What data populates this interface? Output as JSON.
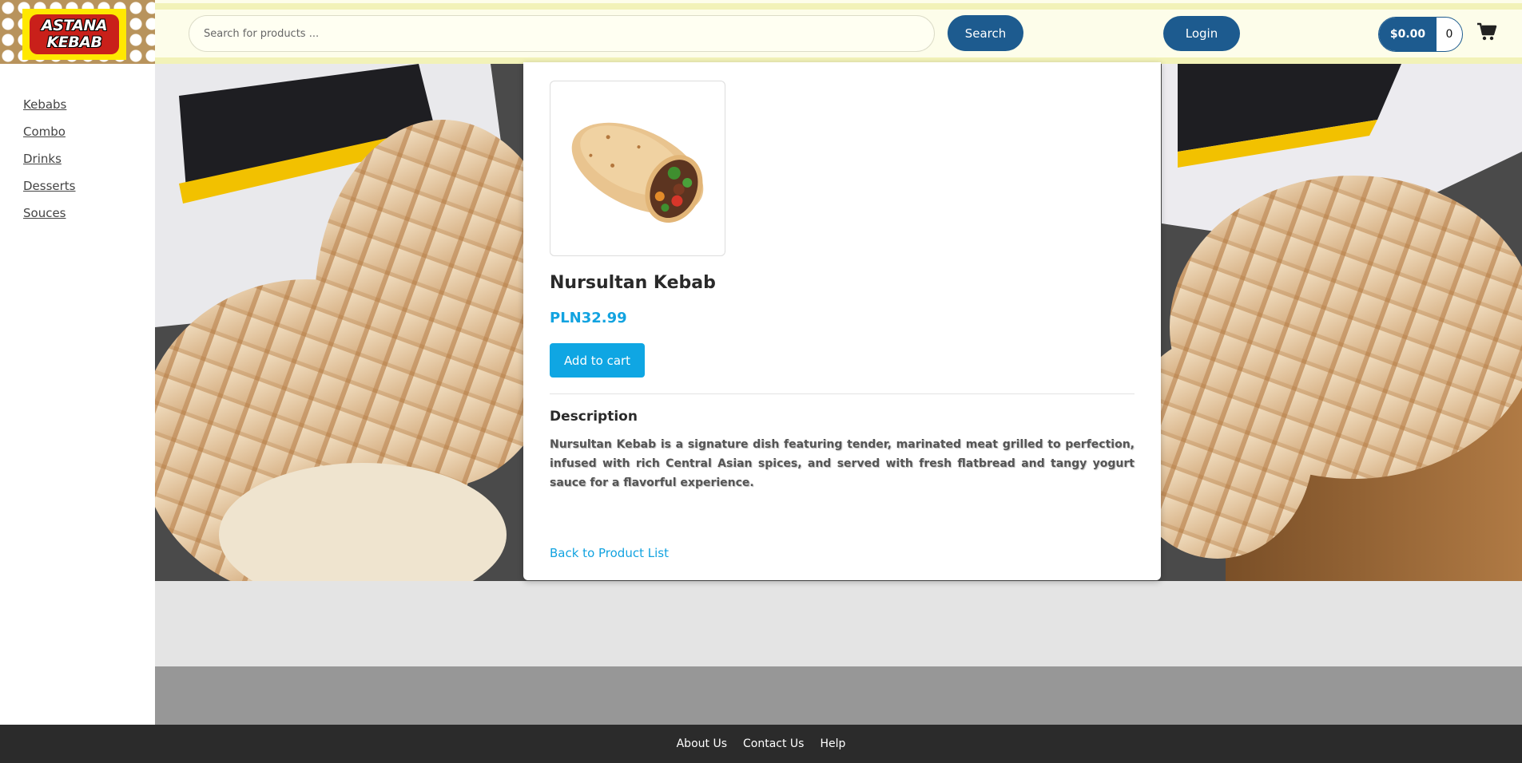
{
  "brand": {
    "logo_line1": "ASTANA",
    "logo_line2": "KEBAB",
    "colors": {
      "header_bg": "#fdfdea",
      "primary": "#1d5b8f",
      "accent": "#0fa6e3",
      "footer_bg": "#2b2b2b"
    }
  },
  "header": {
    "search_placeholder": "Search for products ...",
    "search_label": "Search",
    "login_label": "Login",
    "cart_total": "$0.00",
    "cart_count": "0",
    "cart_icon": "shopping-cart-icon"
  },
  "sidebar": {
    "items": [
      {
        "label": "Kebabs"
      },
      {
        "label": "Combo"
      },
      {
        "label": "Drinks"
      },
      {
        "label": "Desserts"
      },
      {
        "label": "Souces"
      }
    ]
  },
  "product": {
    "name": "Nursultan Kebab",
    "price": "PLN32.99",
    "add_to_cart_label": "Add to cart",
    "description_heading": "Description",
    "description": "Nursultan Kebab is a signature dish featuring tender, marinated meat grilled to perfection, infused with rich Central Asian spices, and served with fresh flatbread and tangy yogurt sauce for a flavorful experience.",
    "back_label": "Back to Product List"
  },
  "footer": {
    "links": [
      {
        "label": "About Us"
      },
      {
        "label": "Contact Us"
      },
      {
        "label": "Help"
      }
    ]
  }
}
